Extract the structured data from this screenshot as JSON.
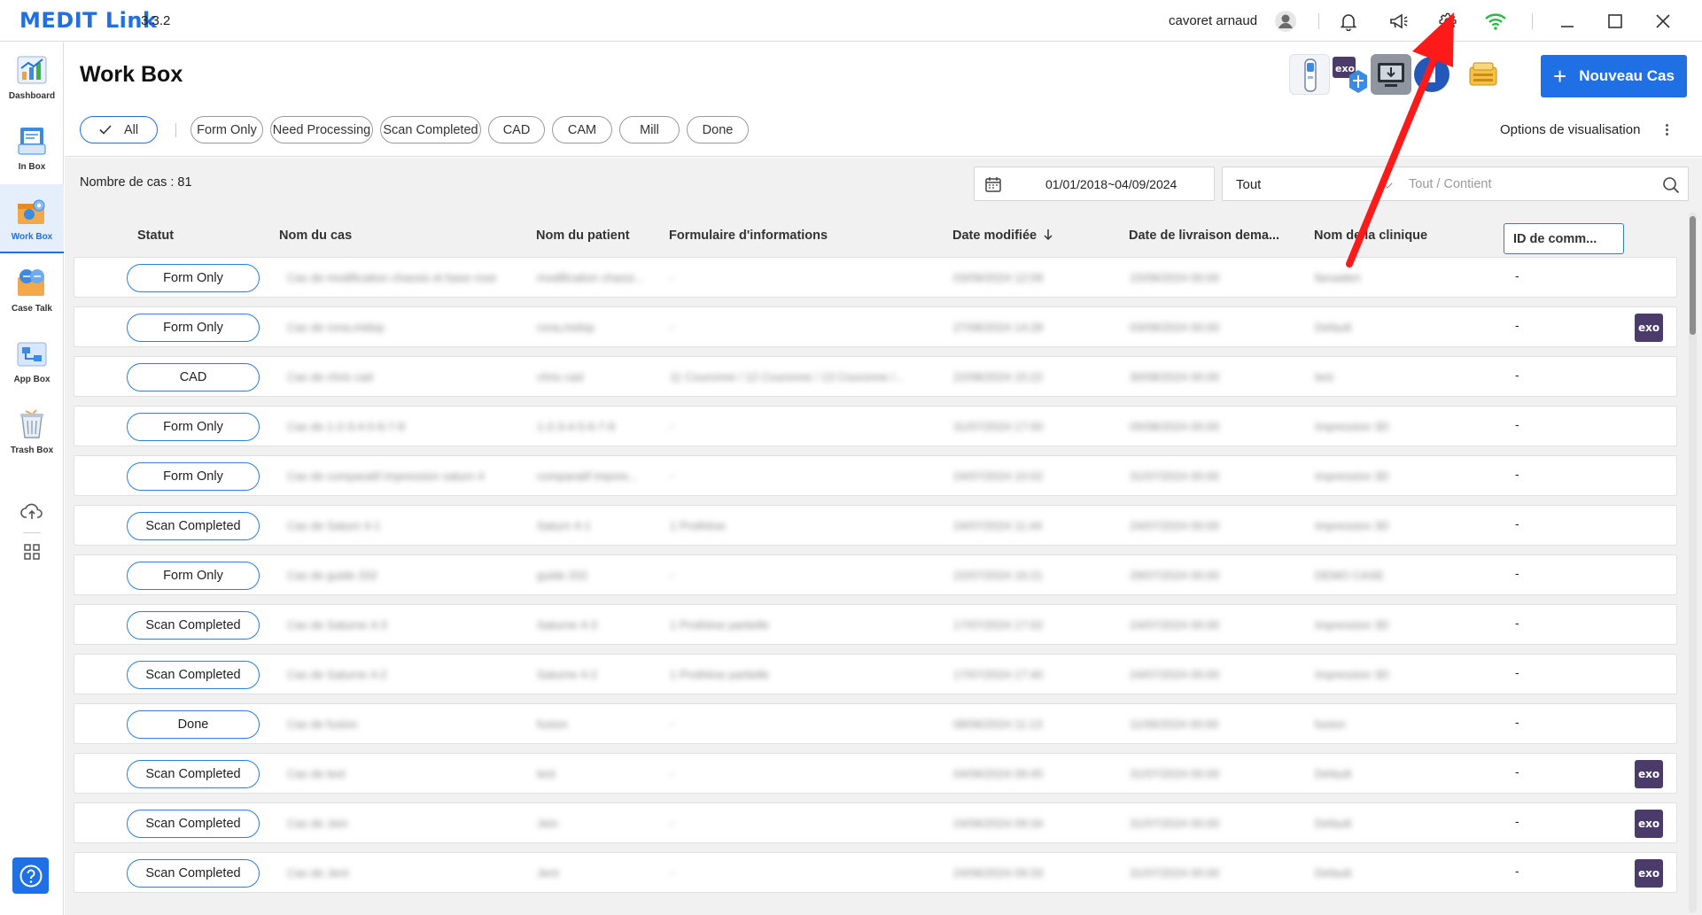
{
  "app": {
    "brand": "MEDIT Link",
    "version": "3.3.2",
    "user": "cavoret arnaud"
  },
  "titlebar_icons": [
    "user-avatar-icon",
    "bell-icon",
    "megaphone-icon",
    "gear-icon",
    "wifi-icon",
    "minimize-icon",
    "maximize-icon",
    "close-icon"
  ],
  "sidebar": {
    "items": [
      {
        "label": "Dashboard",
        "icon": "dashboard-icon"
      },
      {
        "label": "In Box",
        "icon": "inbox-icon"
      },
      {
        "label": "Work Box",
        "icon": "workbox-icon",
        "active": true
      },
      {
        "label": "Case Talk",
        "icon": "case-talk-icon"
      },
      {
        "label": "App Box",
        "icon": "app-box-icon"
      },
      {
        "label": "Trash Box",
        "icon": "trash-icon"
      }
    ],
    "extra_icons": [
      "cloud-sync-icon",
      "grid-apps-icon",
      "help-icon"
    ]
  },
  "header": {
    "title": "Work Box",
    "new_case_label": "Nouveau Cas",
    "view_options_label": "Options de visualisation",
    "filters": [
      "All",
      "Form Only",
      "Need Processing",
      "Scan Completed",
      "CAD",
      "CAM",
      "Mill",
      "Done"
    ],
    "selected_filter": "All"
  },
  "toolbar": {
    "case_count": "Nombre de cas : 81",
    "date_range": "01/01/2018~04/09/2024",
    "search_scope": "Tout",
    "search_placeholder": "Tout / Contient"
  },
  "table": {
    "columns": [
      "Statut",
      "Nom du cas",
      "Nom du patient",
      "Formulaire d'informations",
      "Date modifiée",
      "Date de livraison dema...",
      "Nom de la clinique",
      "ID de comm..."
    ],
    "rows": [
      {
        "status": "Form Only",
        "case": "Cas de modification chassis et base rose",
        "patient": "modification chassi...",
        "form": "-",
        "modified": "03/09/2024 12:09",
        "delivery": "15/09/2024 00:00",
        "clinic": "faroaderi",
        "order_id": "-",
        "exo": false
      },
      {
        "status": "Form Only",
        "case": "Cas de rona,midop",
        "patient": "rona,midop",
        "form": "-",
        "modified": "27/08/2024 14:28",
        "delivery": "03/09/2024 00:00",
        "clinic": "Default",
        "order_id": "-",
        "exo": true
      },
      {
        "status": "CAD",
        "case": "Cas de chris cad",
        "patient": "chris cad",
        "form": "11 Couronne / 12 Couronne / 13 Couronne /...",
        "modified": "22/08/2024 15:22",
        "delivery": "30/08/2024 00:00",
        "clinic": "test",
        "order_id": "-",
        "exo": false
      },
      {
        "status": "Form Only",
        "case": "Cas de 1-2-3-4-5-6-7-8",
        "patient": "1-2-3-4-5-6-7-8",
        "form": "-",
        "modified": "31/07/2024 17:00",
        "delivery": "05/08/2024 00:00",
        "clinic": "Impression 3D",
        "order_id": "-",
        "exo": false
      },
      {
        "status": "Form Only",
        "case": "Cas de comparatif impression saturn 4",
        "patient": "comparatif impres...",
        "form": "-",
        "modified": "24/07/2024 10:02",
        "delivery": "31/07/2024 00:00",
        "clinic": "Impression 3D",
        "order_id": "-",
        "exo": false
      },
      {
        "status": "Scan Completed",
        "case": "Cas de Saturn 4-1",
        "patient": "Saturn 4-1",
        "form": "1 Prothèse",
        "modified": "24/07/2024 11:44",
        "delivery": "24/07/2024 00:00",
        "clinic": "Impression 3D",
        "order_id": "-",
        "exo": false
      },
      {
        "status": "Form Only",
        "case": "Cas de guide 202",
        "patient": "guide 202",
        "form": "-",
        "modified": "22/07/2024 16:21",
        "delivery": "29/07/2024 00:00",
        "clinic": "DEMO CASE",
        "order_id": "-",
        "exo": false
      },
      {
        "status": "Scan Completed",
        "case": "Cas de Saturne 4-3",
        "patient": "Saturne 4-3",
        "form": "1 Prothèse partielle",
        "modified": "17/07/2024 17:02",
        "delivery": "24/07/2024 00:00",
        "clinic": "Impression 3D",
        "order_id": "-",
        "exo": false
      },
      {
        "status": "Scan Completed",
        "case": "Cas de Saturne 4-2",
        "patient": "Saturne 4-2",
        "form": "1 Prothèse partielle",
        "modified": "17/07/2024 17:40",
        "delivery": "24/07/2024 00:00",
        "clinic": "Impression 3D",
        "order_id": "-",
        "exo": false
      },
      {
        "status": "Done",
        "case": "Cas de fusion",
        "patient": "fusion",
        "form": "-",
        "modified": "08/06/2024 11:13",
        "delivery": "11/06/2024 00:00",
        "clinic": "fusion",
        "order_id": "-",
        "exo": false
      },
      {
        "status": "Scan Completed",
        "case": "Cas de test",
        "patient": "test",
        "form": "-",
        "modified": "04/06/2024 09:45",
        "delivery": "31/07/2024 00:00",
        "clinic": "Default",
        "order_id": "-",
        "exo": true
      },
      {
        "status": "Scan Completed",
        "case": "Cas de Jein",
        "patient": "Jein",
        "form": "-",
        "modified": "24/06/2024 09:34",
        "delivery": "31/07/2024 00:00",
        "clinic": "Default",
        "order_id": "-",
        "exo": true
      },
      {
        "status": "Scan Completed",
        "case": "Cas de Jent",
        "patient": "Jent",
        "form": "-",
        "modified": "24/06/2024 09:33",
        "delivery": "31/07/2024 00:00",
        "clinic": "Default",
        "order_id": "-",
        "exo": true
      }
    ],
    "exo_label": "exo"
  },
  "colors": {
    "accent": "#1f6fe5",
    "annotation_arrow": "#ff1a1a",
    "exo_badge": "#4a3b6b",
    "wifi": "#2fb84a"
  }
}
